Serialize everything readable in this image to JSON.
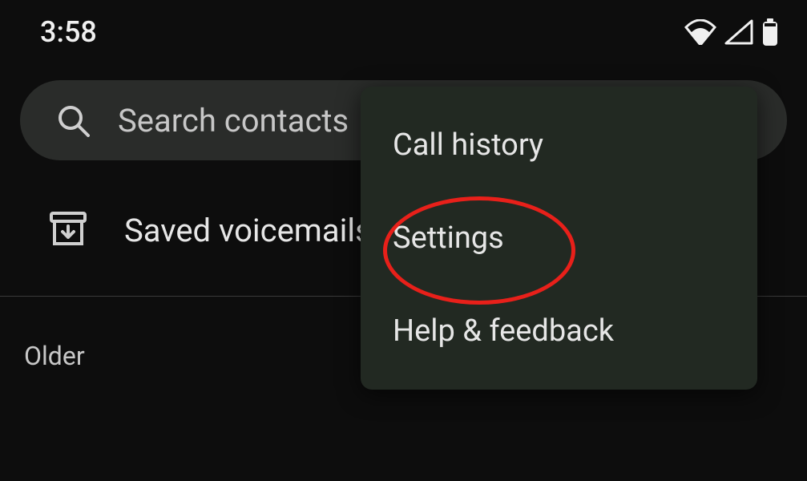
{
  "status": {
    "time": "3:58"
  },
  "search": {
    "placeholder": "Search contacts"
  },
  "voicemails": {
    "label": "Saved voicemails (0)"
  },
  "section": {
    "older": "Older"
  },
  "menu": {
    "items": [
      {
        "label": "Call history"
      },
      {
        "label": "Settings"
      },
      {
        "label": "Help & feedback"
      }
    ]
  }
}
